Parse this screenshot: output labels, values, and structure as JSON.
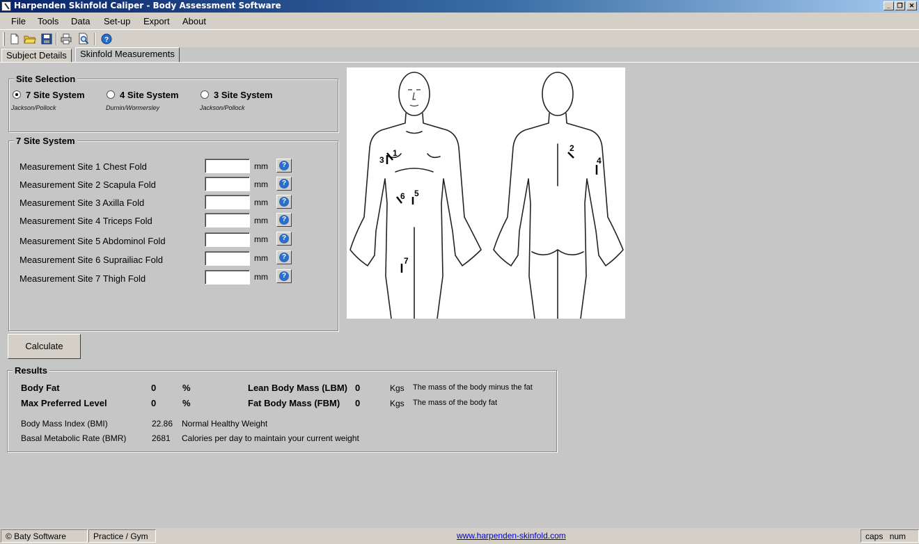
{
  "window": {
    "title": "Harpenden Skinfold Caliper - Body Assessment Software",
    "controls": {
      "minimize": "_",
      "restore": "❐",
      "close": "✕"
    }
  },
  "menu": [
    "File",
    "Tools",
    "Data",
    "Set-up",
    "Export",
    "About"
  ],
  "toolbar": {
    "icons": [
      "new-file-icon",
      "open-folder-icon",
      "save-icon",
      "print-icon",
      "print-preview-icon",
      "help-icon"
    ]
  },
  "tabs": [
    "Subject Details",
    "Skinfold Measurements"
  ],
  "site_selection": {
    "title": "Site Selection",
    "options": [
      {
        "label": "7 Site System",
        "sub": "Jackson/Pollock",
        "checked": true
      },
      {
        "label": "4 Site System",
        "sub": "Durnin/Wormersley",
        "checked": false
      },
      {
        "label": "3 Site System",
        "sub": "Jackson/Pollock",
        "checked": false
      }
    ]
  },
  "measurements": {
    "title": "7 Site System",
    "unit": "mm",
    "help": "?",
    "sites": [
      {
        "label": "Measurement Site 1 Chest Fold",
        "value": ""
      },
      {
        "label": "Measurement Site 2 Scapula Fold",
        "value": ""
      },
      {
        "label": "Measurement Site 3 Axilla Fold",
        "value": ""
      },
      {
        "label": "Measurement Site 4 Triceps Fold",
        "value": ""
      },
      {
        "label": "Measurement Site 5 Abdominol Fold",
        "value": ""
      },
      {
        "label": "Measurement Site 6 Suprailiac Fold",
        "value": ""
      },
      {
        "label": "Measurement Site 7 Thigh Fold",
        "value": ""
      }
    ]
  },
  "diagram_markers": [
    "1",
    "2",
    "3",
    "4",
    "5",
    "6",
    "7"
  ],
  "calculate_label": "Calculate",
  "results": {
    "title": "Results",
    "body_fat": {
      "label": "Body Fat",
      "value": "0",
      "unit": "%"
    },
    "max_pref": {
      "label": "Max Preferred Level",
      "value": "0",
      "unit": "%"
    },
    "lbm": {
      "label": "Lean Body Mass (LBM)",
      "value": "0",
      "unit": "Kgs",
      "desc": "The mass of the body minus the fat"
    },
    "fbm": {
      "label": "Fat Body Mass (FBM)",
      "value": "0",
      "unit": "Kgs",
      "desc": "The mass of the body fat"
    },
    "bmi": {
      "label": "Body Mass Index (BMI)",
      "value": "22.86",
      "desc": "Normal Healthy Weight"
    },
    "bmr": {
      "label": "Basal Metabolic Rate (BMR)",
      "value": "2681",
      "desc": "Calories per day to maintain your current weight"
    }
  },
  "status": {
    "left": "© Baty Software",
    "mode": "Practice / Gym",
    "link": "www.harpenden-skinfold.com",
    "caps": "caps",
    "num": "num"
  }
}
